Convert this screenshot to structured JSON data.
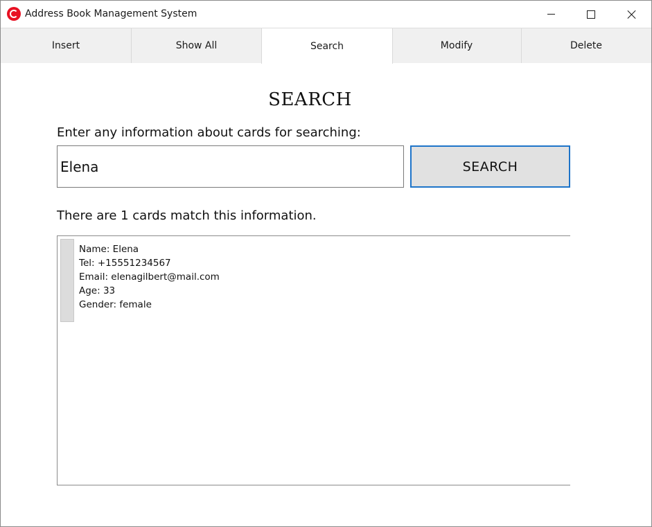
{
  "window": {
    "title": "Address Book Management System",
    "accent_color": "#1d74c9",
    "icon_color": "#e81123"
  },
  "tabs": [
    {
      "label": "Insert"
    },
    {
      "label": "Show All"
    },
    {
      "label": "Search",
      "active": true
    },
    {
      "label": "Modify"
    },
    {
      "label": "Delete"
    }
  ],
  "search_page": {
    "heading": "SEARCH",
    "prompt": "Enter any information about cards for searching:",
    "input_value": "Elena",
    "button_label": "SEARCH",
    "result_count_text": "There are 1 cards match this information."
  },
  "results": [
    {
      "lines": [
        "Name: Elena",
        "Tel: +15551234567",
        "Email: elenagilbert@mail.com",
        "Age: 33",
        "Gender: female"
      ]
    }
  ]
}
